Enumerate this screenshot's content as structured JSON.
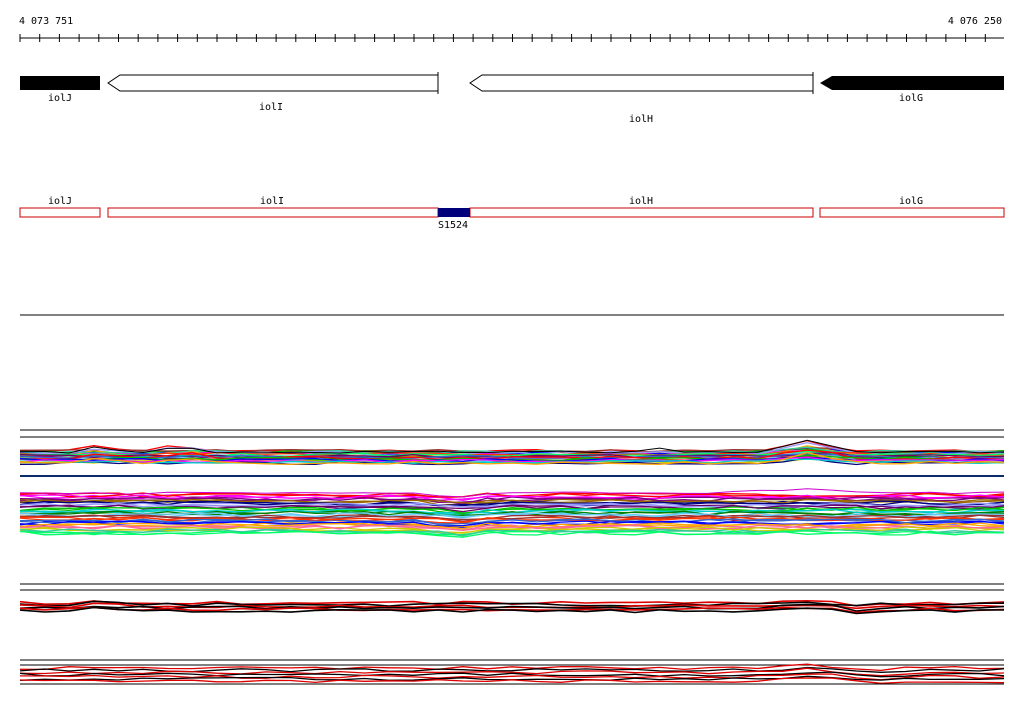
{
  "coords": {
    "start_label": "4 073 751",
    "end_label": "4 076 250"
  },
  "genes": [
    {
      "name": "iolJ",
      "strand": "+",
      "style": "filled"
    },
    {
      "name": "iolI",
      "strand": "-",
      "style": "open"
    },
    {
      "name": "iolH",
      "strand": "-",
      "style": "open"
    },
    {
      "name": "iolG",
      "strand": "-",
      "style": "filled"
    }
  ],
  "segment_labels": [
    "iolJ",
    "iolI",
    "iolH",
    "iolG"
  ],
  "feature": {
    "name": "S1524",
    "color": "#00007a"
  },
  "colors": {
    "gene_box": "#cc0000",
    "axis": "#000000"
  }
}
